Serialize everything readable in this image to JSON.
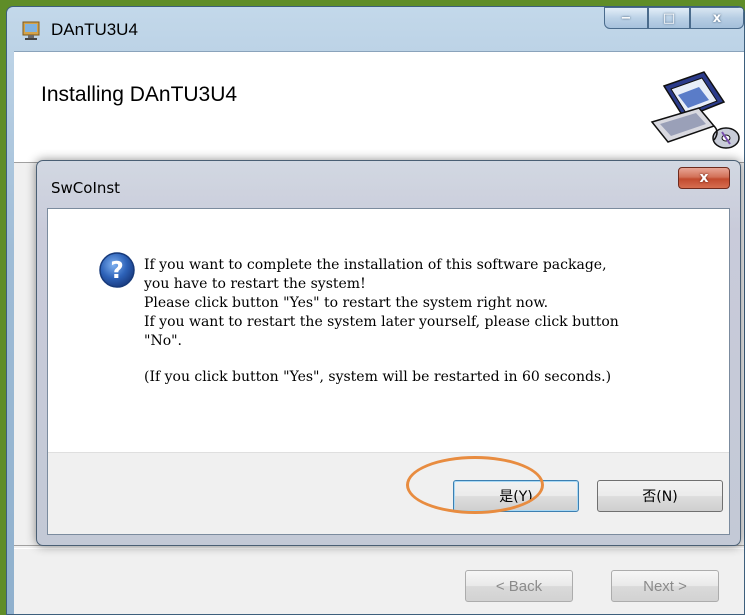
{
  "installer": {
    "title": "DAnTU3U4",
    "heading": "Installing DAnTU3U4",
    "window_controls": {
      "minimize": "−",
      "maximize": "□",
      "close": "x"
    },
    "back_label": "< Back",
    "next_label": "Next >"
  },
  "dialog": {
    "title": "SwCoInst",
    "close_glyph": "x",
    "icon": "question-icon",
    "message_lines": [
      "If you want to complete the installation of this software package,",
      "you have to restart the system!",
      "Please click button \"Yes\" to restart the system right now.",
      "If you want to restart the system later yourself, please click button",
      "\"No\"."
    ],
    "note": "(If you click button \"Yes\", system will be restarted in 60 seconds.)",
    "yes_label": "是(Y)",
    "no_label": "否(N)"
  },
  "colors": {
    "annotation": "#e88c40",
    "close_button": "#c24b2f",
    "question_icon": "#2d62b8"
  }
}
